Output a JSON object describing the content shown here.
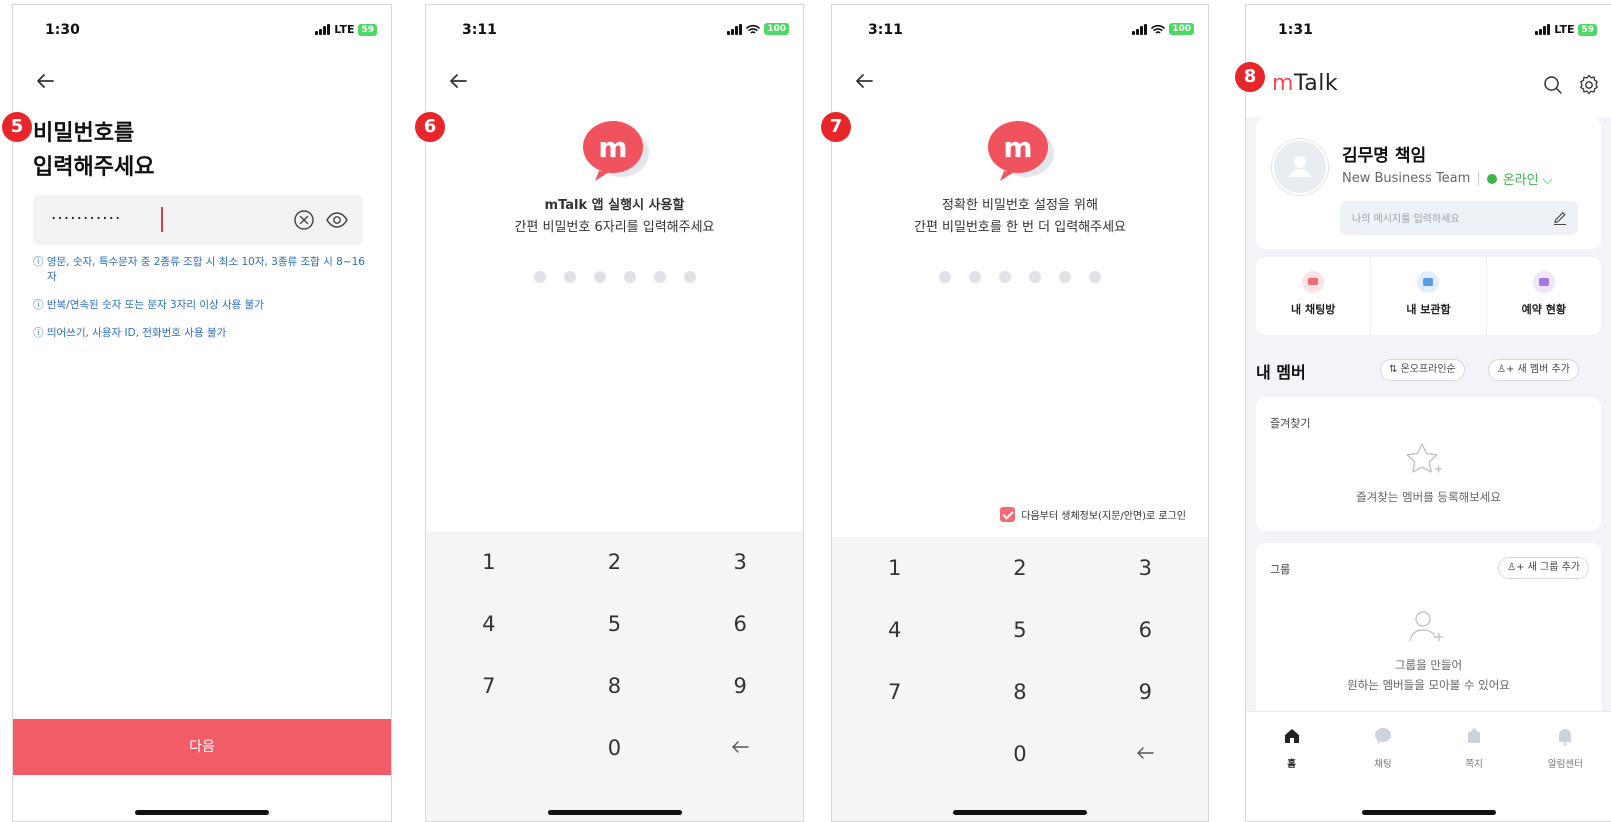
{
  "badges": {
    "p5": "5",
    "p6": "6",
    "p7": "7",
    "p8": "8"
  },
  "screen5": {
    "time": "1:30",
    "network": "LTE",
    "battery": "59",
    "title_line1": "비밀번호를",
    "title_line2": "입력해주세요",
    "password_mask": "···········",
    "rules": [
      "ⓘ 영문, 숫자, 특수문자 중 2종류 조합 시 최소 10자, 3종류 조합 시 8~16자",
      "ⓘ 반복/연속된 숫자 또는 문자 3자리 이상 사용 불가",
      "ⓘ 띄어쓰기, 사용자 ID, 전화번호 사용 불가"
    ],
    "next_label": "다음"
  },
  "screen6": {
    "time": "3:11",
    "battery": "100",
    "message_line1": "mTalk  앱 실행시 사용할",
    "message_line2": "간편 비밀번호 6자리를 입력해주세요",
    "keys": [
      "1",
      "2",
      "3",
      "4",
      "5",
      "6",
      "7",
      "8",
      "9",
      "",
      "0"
    ]
  },
  "screen7": {
    "time": "3:11",
    "battery": "100",
    "message_line1": "정확한 비밀번호 설정을 위해",
    "message_line2": "간편 비밀번호를 한 번 더 입력해주세요",
    "biometric_label": "다음부터 생체정보(지문/안면)로 로그인",
    "biometric_checked": true,
    "keys": [
      "1",
      "2",
      "3",
      "4",
      "5",
      "6",
      "7",
      "8",
      "9",
      "",
      "0"
    ]
  },
  "screen8": {
    "time": "1:31",
    "network": "LTE",
    "battery": "59",
    "brand_m": "m",
    "brand_rest": "Talk",
    "profile_name": "김무명 책임",
    "profile_team": "New Business Team",
    "profile_status": "온라인",
    "status_placeholder": "나의 메시지를 입력하세요",
    "quick_items": [
      "내 채팅방",
      "내 보관함",
      "예약 현황"
    ],
    "members_label": "내 멤버",
    "sort_chip": "온오프라인순",
    "add_member_chip": "새 멤버 추가",
    "favorites_title": "즐겨찾기",
    "favorites_empty": "즐겨찾는 멤버를 등록해보세요",
    "group_title": "그룹",
    "add_group_chip": "새 그룹 추가",
    "group_empty_line1": "그룹을 만들어",
    "group_empty_line2": "원하는 멤버들을 모아볼 수 있어요",
    "tabs": [
      "홈",
      "채팅",
      "쪽지",
      "알림센터"
    ]
  },
  "colors": {
    "accent": "#f25c67",
    "badge": "#e8262a",
    "online": "#3ab54a",
    "rule_text": "#2a6fbf"
  }
}
